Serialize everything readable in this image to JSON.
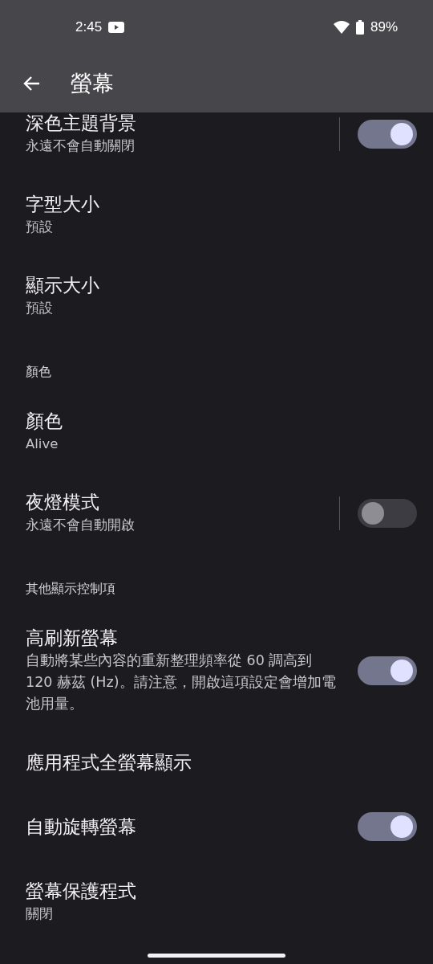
{
  "status_bar": {
    "time": "2:45",
    "battery": "89%"
  },
  "app_bar": {
    "title": "螢幕"
  },
  "items": [
    {
      "kind": "setting",
      "title": "深色主題背景",
      "subtitle": "永遠不會自動關閉",
      "toggle": {
        "on": true,
        "split": true
      }
    },
    {
      "kind": "setting",
      "title": "字型大小",
      "subtitle": "預設"
    },
    {
      "kind": "setting",
      "title": "顯示大小",
      "subtitle": "預設"
    },
    {
      "kind": "header",
      "title": "顏色"
    },
    {
      "kind": "setting",
      "title": "顏色",
      "subtitle": "Alive"
    },
    {
      "kind": "setting",
      "title": "夜燈模式",
      "subtitle": "永遠不會自動開啟",
      "toggle": {
        "on": false,
        "split": true
      }
    },
    {
      "kind": "header",
      "title": "其他顯示控制項"
    },
    {
      "kind": "setting",
      "title": "高刷新螢幕",
      "subtitle": "自動將某些內容的重新整理頻率從 60 調高到 120 赫茲 (Hz)。請注意，開啟這項設定會增加電池用量。",
      "toggle": {
        "on": true,
        "split": false
      }
    },
    {
      "kind": "setting",
      "title": "應用程式全螢幕顯示"
    },
    {
      "kind": "setting",
      "title": "自動旋轉螢幕",
      "toggle": {
        "on": true,
        "split": false
      }
    },
    {
      "kind": "setting",
      "title": "螢幕保護程式",
      "subtitle": "關閉"
    }
  ]
}
